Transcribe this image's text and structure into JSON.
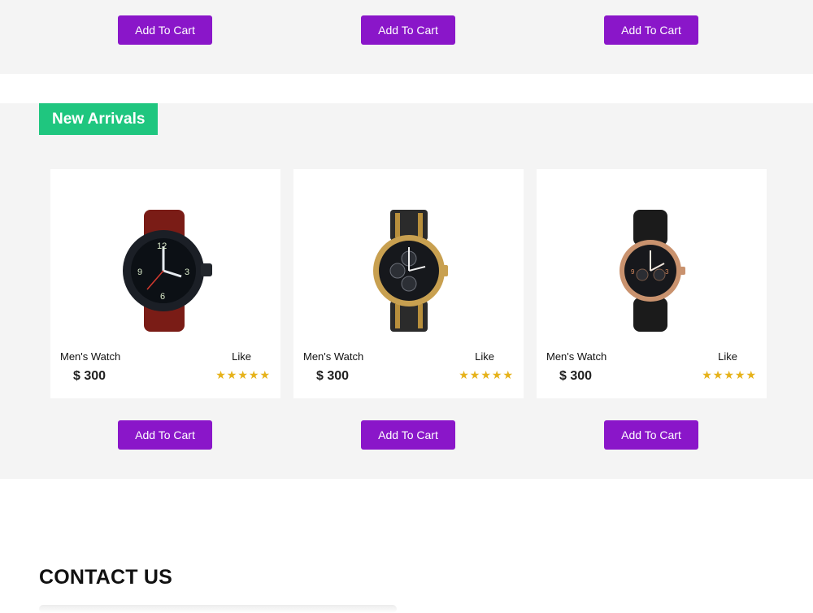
{
  "top_row": {
    "buttons": [
      "Add To Cart",
      "Add To Cart",
      "Add To Cart"
    ]
  },
  "arrivals": {
    "title": "New Arrivals",
    "products": [
      {
        "name": "Men's Watch",
        "like_label": "Like",
        "price": "$ 300",
        "rating": 5,
        "cart_label": "Add To Cart",
        "image": "watch-leather-red-strap"
      },
      {
        "name": "Men's Watch",
        "like_label": "Like",
        "price": "$ 300",
        "rating": 5,
        "cart_label": "Add To Cart",
        "image": "watch-steel-gold-chronograph"
      },
      {
        "name": "Men's Watch",
        "like_label": "Like",
        "price": "$ 300",
        "rating": 5,
        "cart_label": "Add To Cart",
        "image": "watch-rose-gold-black-strap"
      }
    ]
  },
  "contact": {
    "title": "CONTACT US"
  },
  "colors": {
    "button": "#8a16c9",
    "badge": "#1fc67f",
    "star": "#e6b21a",
    "section_bg": "#f4f4f4"
  }
}
